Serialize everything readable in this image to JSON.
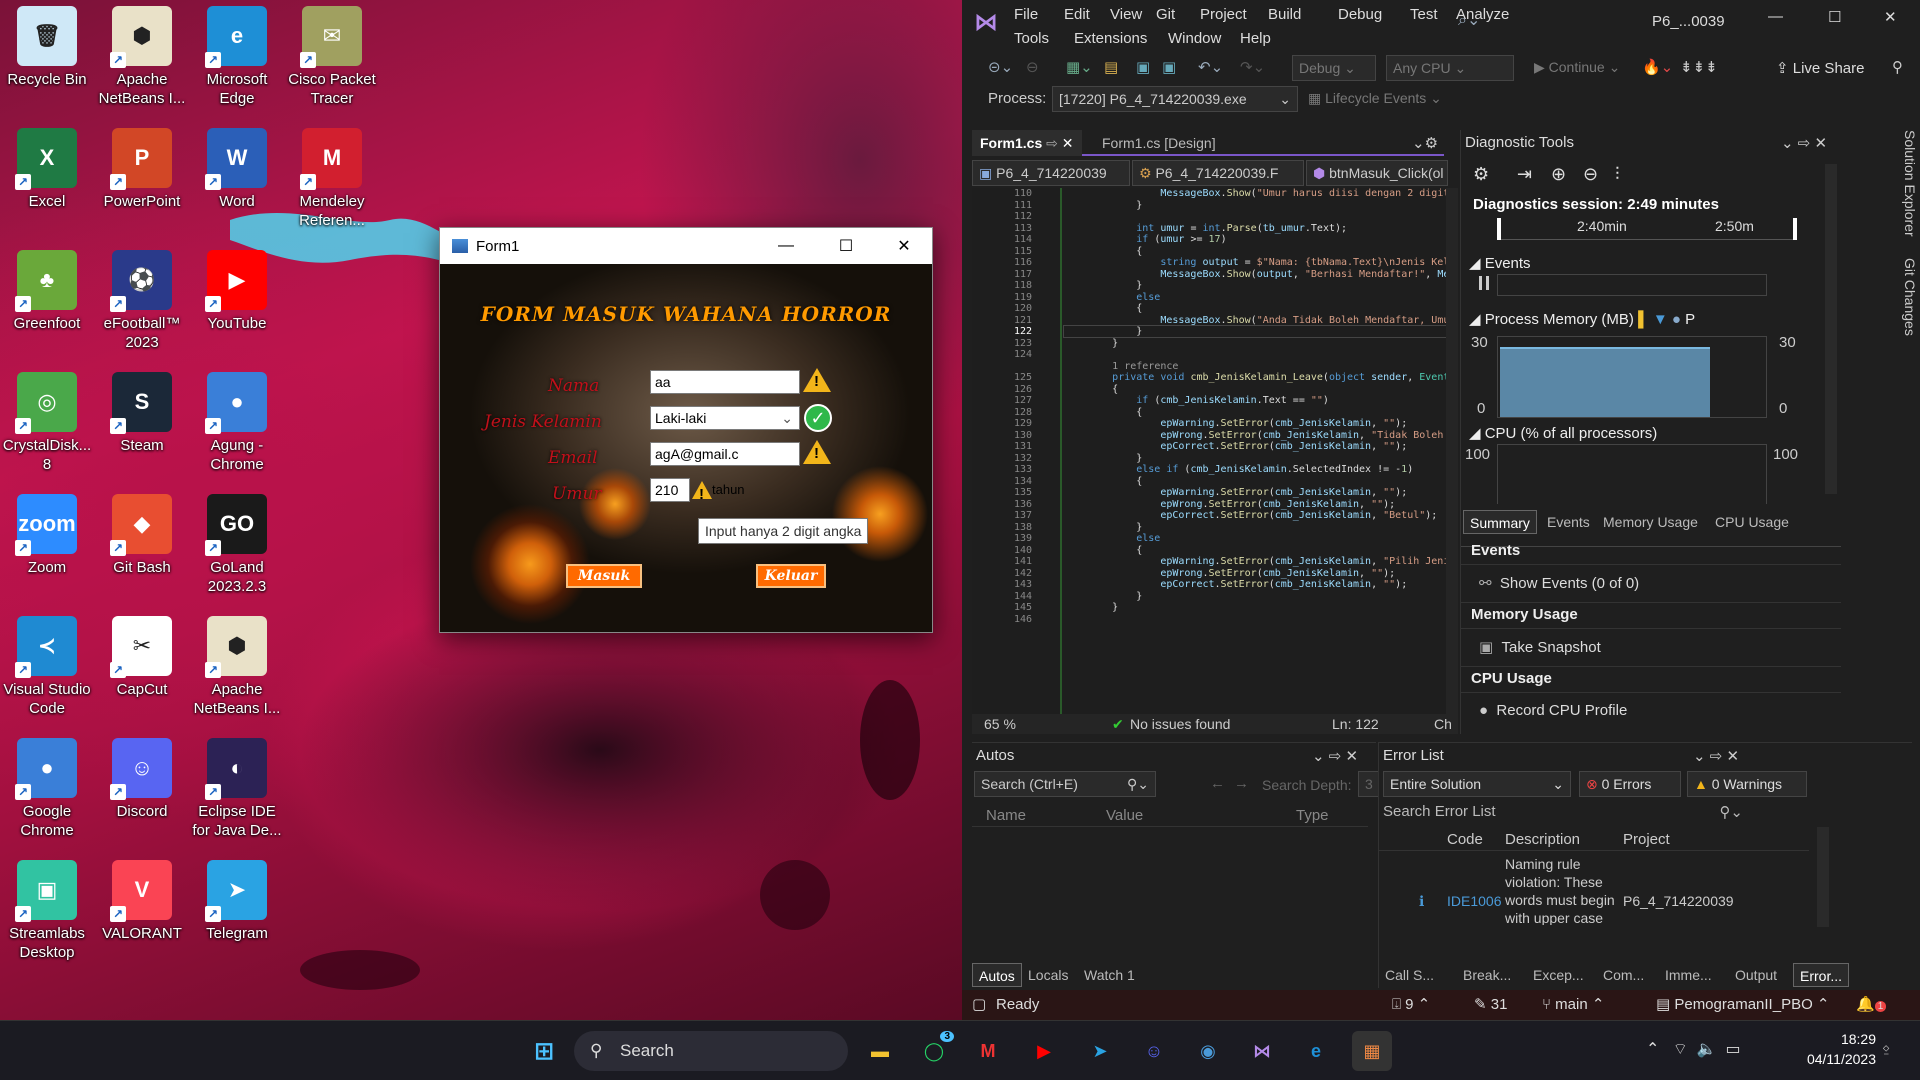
{
  "desktop": {
    "icons": [
      {
        "label": "Recycle Bin",
        "glyph": "🗑",
        "color": "#cfe8f7"
      },
      {
        "label": "Apache NetBeans I...",
        "glyph": "⬢",
        "color": "#e9e1c8"
      },
      {
        "label": "Microsoft Edge",
        "glyph": "e",
        "color": "#1e8fd6"
      },
      {
        "label": "Cisco Packet Tracer",
        "glyph": "✉",
        "color": "#a0a060"
      },
      {
        "label": "Excel",
        "glyph": "X",
        "color": "#1f7a44"
      },
      {
        "label": "PowerPoint",
        "glyph": "P",
        "color": "#d24726"
      },
      {
        "label": "Word",
        "glyph": "W",
        "color": "#2b5fb8"
      },
      {
        "label": "Mendeley Referen...",
        "glyph": "M",
        "color": "#d21f2f"
      },
      {
        "label": "Greenfoot",
        "glyph": "♣",
        "color": "#6aa83a"
      },
      {
        "label": "eFootball™ 2023",
        "glyph": "⚽",
        "color": "#2a3a8a"
      },
      {
        "label": "YouTube",
        "glyph": "▶",
        "color": "#ff0000"
      },
      {
        "label": "CrystalDisk... 8",
        "glyph": "◎",
        "color": "#4aa84a"
      },
      {
        "label": "Steam",
        "glyph": "S",
        "color": "#1b2838"
      },
      {
        "label": "Agung - Chrome",
        "glyph": "●",
        "color": "#3a7fd8"
      },
      {
        "label": "Zoom",
        "glyph": "zoom",
        "color": "#2d8cff"
      },
      {
        "label": "Git Bash",
        "glyph": "◆",
        "color": "#e84e31"
      },
      {
        "label": "GoLand 2023.2.3",
        "glyph": "GO",
        "color": "#1a1a1a"
      },
      {
        "label": "Visual Studio Code",
        "glyph": "≺",
        "color": "#1f8ad2"
      },
      {
        "label": "CapCut",
        "glyph": "✂",
        "color": "#ffffff"
      },
      {
        "label": "Apache NetBeans I...",
        "glyph": "⬢",
        "color": "#e9e1c8"
      },
      {
        "label": "Google Chrome",
        "glyph": "●",
        "color": "#3a7fd8"
      },
      {
        "label": "Discord",
        "glyph": "☺",
        "color": "#5865f2"
      },
      {
        "label": "Eclipse IDE for Java De...",
        "glyph": "◐",
        "color": "#2c2255"
      },
      {
        "label": "Streamlabs Desktop",
        "glyph": "▣",
        "color": "#31c3a2"
      },
      {
        "label": "VALORANT",
        "glyph": "V",
        "color": "#fa4454"
      },
      {
        "label": "Telegram",
        "glyph": "➤",
        "color": "#2aa3e3"
      }
    ]
  },
  "form1": {
    "title": "Form1",
    "heading": "FORM MASUK WAHANA HORROR",
    "labels": {
      "nama": "Nama",
      "jk": "Jenis Kelamin",
      "email": "Email",
      "umur": "Umur"
    },
    "values": {
      "nama": "aa",
      "jk": "Laki-laki",
      "email": "agA@gmail.c",
      "umur": "210"
    },
    "umur_suffix": "tahun",
    "tooltip": "Input hanya 2 digit angka",
    "btn_masuk": "Masuk",
    "btn_keluar": "Keluar"
  },
  "vs": {
    "menu_row1": [
      "File",
      "Edit",
      "View",
      "Git",
      "Project",
      "Build",
      "Debug",
      "Test",
      "Analyze"
    ],
    "menu_row2": [
      "Tools",
      "Extensions",
      "Window",
      "Help"
    ],
    "window_title": "P6_...0039",
    "config": "Debug",
    "platform": "Any CPU",
    "continue": "Continue",
    "live_share": "Live Share",
    "process_label": "Process:",
    "process_value": "[17220] P6_4_714220039.exe",
    "lifecycle": "Lifecycle Events",
    "tabs": [
      "Form1.cs",
      "Form1.cs [Design]"
    ],
    "nav": [
      "P6_4_714220039",
      "P6_4_714220039.F",
      "btnMasuk_Click(ol"
    ],
    "zoom": "65 %",
    "issues": "No issues found",
    "ln_col": "Ln: 122",
    "ch": "Ch",
    "code_lines": [
      {
        "n": "110",
        "html": "                <span class='v'>MessageBox</span>.<span class='m'>Show</span>(<span class='s'>\"Umur harus diisi dengan 2 digit an</span>"
      },
      {
        "n": "111",
        "html": "            }"
      },
      {
        "n": "112",
        "html": ""
      },
      {
        "n": "113",
        "html": "            <span class='k'>int</span> <span class='v'>umur</span> = <span class='k'>int</span>.<span class='m'>Parse</span>(<span class='v'>tb_umur</span>.Text);"
      },
      {
        "n": "114",
        "html": "            <span class='k'>if</span> (<span class='v'>umur</span> &gt;= <span class='n'>17</span>)"
      },
      {
        "n": "115",
        "html": "            {"
      },
      {
        "n": "116",
        "html": "                <span class='k'>string</span> <span class='v'>output</span> = <span class='s'>$\"Nama: {tbNama.Text}\\nJenis Kelami</span>"
      },
      {
        "n": "117",
        "html": "                <span class='v'>MessageBox</span>.<span class='m'>Show</span>(<span class='v'>output</span>, <span class='s'>\"Berhasi Mendaftar!\"</span>, <span class='v'>Messag</span>"
      },
      {
        "n": "118",
        "html": "            }"
      },
      {
        "n": "119",
        "html": "            <span class='k'>else</span>"
      },
      {
        "n": "120",
        "html": "            {"
      },
      {
        "n": "121",
        "html": "                <span class='v'>MessageBox</span>.<span class='m'>Show</span>(<span class='s'>\"Anda Tidak Boleh Mendaftar, Umur an</span>"
      },
      {
        "n": "122",
        "html": "            }"
      },
      {
        "n": "123",
        "html": "        }"
      },
      {
        "n": "124",
        "html": ""
      },
      {
        "n": "",
        "html": "        <span class='c'>1 reference</span>"
      },
      {
        "n": "125",
        "html": "        <span class='k'>private void</span> <span class='m'>cmb_JenisKelamin_Leave</span>(<span class='k'>object</span> <span class='v'>sender</span>, <span class='t'>EventArg</span>"
      },
      {
        "n": "126",
        "html": "        {"
      },
      {
        "n": "127",
        "html": "            <span class='k'>if</span> (<span class='v'>cmb_JenisKelamin</span>.Text == <span class='s'>\"\"</span>)"
      },
      {
        "n": "128",
        "html": "            {"
      },
      {
        "n": "129",
        "html": "                <span class='v'>epWarning</span>.<span class='m'>SetError</span>(<span class='v'>cmb_JenisKelamin</span>, <span class='s'>\"\"</span>);"
      },
      {
        "n": "130",
        "html": "                <span class='v'>epWrong</span>.<span class='m'>SetError</span>(<span class='v'>cmb_JenisKelamin</span>, <span class='s'>\"Tidak Boleh Kos</span>"
      },
      {
        "n": "131",
        "html": "                <span class='v'>epCorrect</span>.<span class='m'>SetError</span>(<span class='v'>cmb_JenisKelamin</span>, <span class='s'>\"\"</span>);"
      },
      {
        "n": "132",
        "html": "            }"
      },
      {
        "n": "133",
        "html": "            <span class='k'>else if</span> (<span class='v'>cmb_JenisKelamin</span>.SelectedIndex != -<span class='n'>1</span>)"
      },
      {
        "n": "134",
        "html": "            {"
      },
      {
        "n": "135",
        "html": "                <span class='v'>epWarning</span>.<span class='m'>SetError</span>(<span class='v'>cmb_JenisKelamin</span>, <span class='s'>\"\"</span>);"
      },
      {
        "n": "136",
        "html": "                <span class='v'>epWrong</span>.<span class='m'>SetError</span>(<span class='v'>cmb_JenisKelamin</span>, <span class='s'>\"\"</span>);"
      },
      {
        "n": "137",
        "html": "                <span class='v'>epCorrect</span>.<span class='m'>SetError</span>(<span class='v'>cmb_JenisKelamin</span>, <span class='s'>\"Betul\"</span>);"
      },
      {
        "n": "138",
        "html": "            }"
      },
      {
        "n": "139",
        "html": "            <span class='k'>else</span>"
      },
      {
        "n": "140",
        "html": "            {"
      },
      {
        "n": "141",
        "html": "                <span class='v'>epWarning</span>.<span class='m'>SetError</span>(<span class='v'>cmb_JenisKelamin</span>, <span class='s'>\"Pilih Jenis K</span>"
      },
      {
        "n": "142",
        "html": "                <span class='v'>epWrong</span>.<span class='m'>SetError</span>(<span class='v'>cmb_JenisKelamin</span>, <span class='s'>\"\"</span>);"
      },
      {
        "n": "143",
        "html": "                <span class='v'>epCorrect</span>.<span class='m'>SetError</span>(<span class='v'>cmb_JenisKelamin</span>, <span class='s'>\"\"</span>);"
      },
      {
        "n": "144",
        "html": "            }"
      },
      {
        "n": "145",
        "html": "        }"
      },
      {
        "n": "146",
        "html": ""
      }
    ],
    "diag": {
      "title": "Diagnostic Tools",
      "session": "Diagnostics session: 2:49 minutes",
      "t1": "2:40min",
      "t2": "2:50m",
      "events": "Events",
      "process_memory": "Process Memory (MB)",
      "mem_max": "30",
      "mem_min": "0",
      "cpu": "CPU (% of all processors)",
      "cpu_max": "100",
      "p": "P",
      "tabs": [
        "Summary",
        "Events",
        "Memory Usage",
        "CPU Usage"
      ],
      "events_h": "Events",
      "show_events": "Show Events (0 of 0)",
      "mem_h": "Memory Usage",
      "snapshot": "Take Snapshot",
      "cpu_h": "CPU Usage",
      "record": "Record CPU Profile"
    },
    "side_tabs": [
      "Solution Explorer",
      "Git Changes"
    ],
    "autos": {
      "title": "Autos",
      "search": "Search (Ctrl+E)",
      "depth_label": "Search Depth:",
      "depth": "3",
      "cols": [
        "Name",
        "Value",
        "Type"
      ],
      "tabs": [
        "Autos",
        "Locals",
        "Watch 1"
      ]
    },
    "errors": {
      "title": "Error List",
      "scope": "Entire Solution",
      "errors": "0 Errors",
      "warnings": "0 Warnings",
      "search": "Search Error List",
      "cols": [
        "Code",
        "Description",
        "Project"
      ],
      "row": {
        "code": "IDE1006",
        "desc": "Naming rule violation: These words must begin with upper case",
        "project": "P6_4_714220039"
      },
      "tabs": [
        "Call S...",
        "Break...",
        "Excep...",
        "Com...",
        "Imme...",
        "Output",
        "Error..."
      ]
    },
    "status": {
      "ready": "Ready",
      "up": "9",
      "edits": "31",
      "branch": "main",
      "repo": "PemogramanII_PBO",
      "bell": "1"
    }
  },
  "taskbar": {
    "search": "Search",
    "time": "18:29",
    "date": "04/11/2023",
    "whatsapp_badge": "3"
  }
}
